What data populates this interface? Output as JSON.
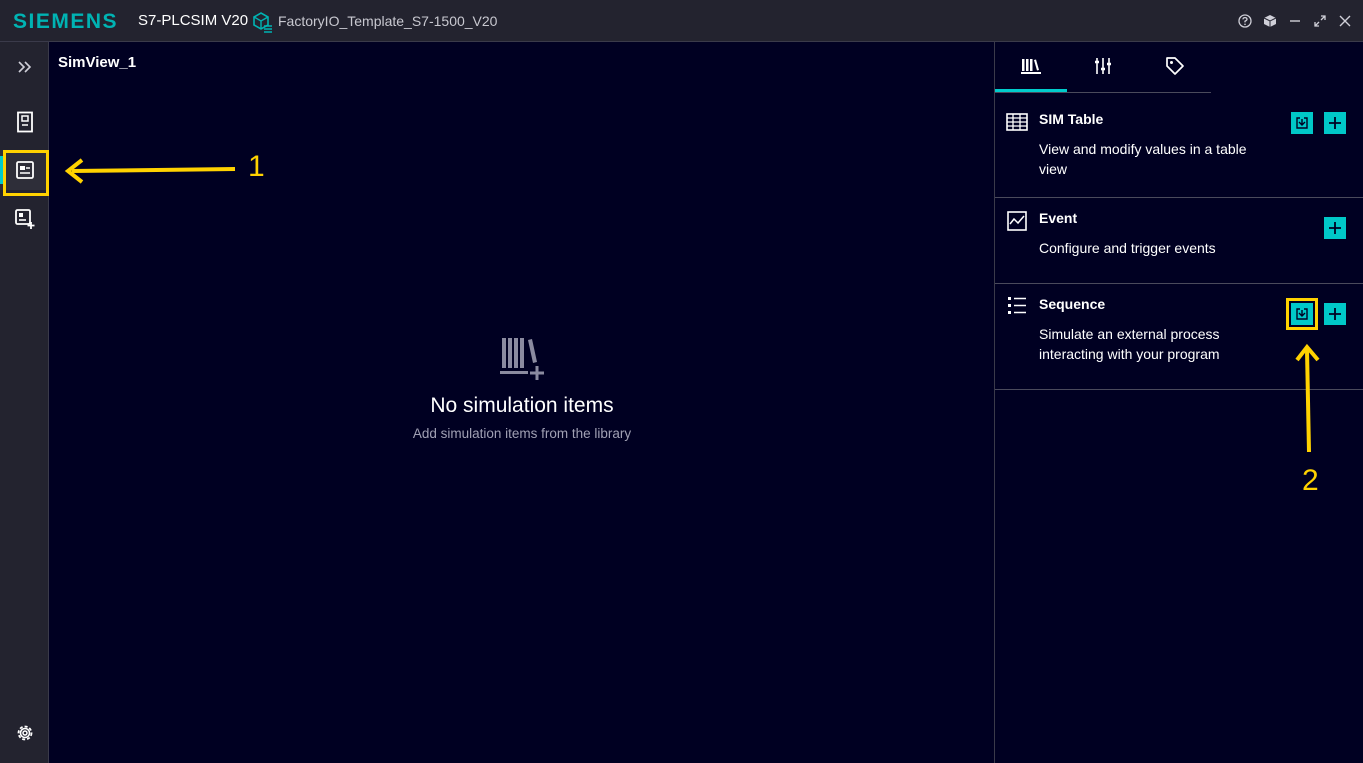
{
  "titlebar": {
    "brand": "SIEMENS",
    "app_title": "S7-PLCSIM V20",
    "project_name": "FactoryIO_Template_S7-1500_V20"
  },
  "sidebar": {
    "items": [
      {
        "icon": "chevron-double-right-icon"
      },
      {
        "icon": "plc-device-icon"
      },
      {
        "icon": "simview-icon",
        "active": true
      },
      {
        "icon": "add-simview-icon"
      },
      {
        "icon": "gear-icon"
      }
    ]
  },
  "main": {
    "view_title": "SimView_1",
    "empty_title": "No simulation items",
    "empty_subtitle": "Add simulation items from the library"
  },
  "panel": {
    "tabs": [
      {
        "icon": "library-icon",
        "active": true
      },
      {
        "icon": "sliders-icon"
      },
      {
        "icon": "tag-icon"
      }
    ],
    "library": [
      {
        "title": "SIM Table",
        "description": "View and modify values in a table view",
        "icon": "table-icon"
      },
      {
        "title": "Event",
        "description": "Configure and trigger events",
        "icon": "event-chart-icon"
      },
      {
        "title": "Sequence",
        "description": "Simulate an external process interacting with your program",
        "icon": "sequence-list-icon"
      }
    ]
  },
  "annotations": {
    "label_1": "1",
    "label_2": "2"
  },
  "colors": {
    "background": "#000022",
    "bars": "#23232f",
    "accent": "#00c8c8",
    "highlight": "#ffd200"
  }
}
